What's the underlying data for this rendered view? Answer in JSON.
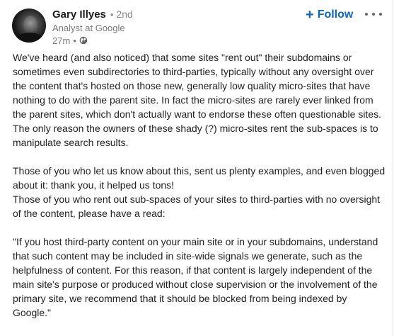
{
  "post": {
    "author": {
      "name": "Gary Illyes",
      "separator": "•",
      "degree": "2nd",
      "headline": "Analyst at Google",
      "time_ago": "27m",
      "meta_separator": "•",
      "visibility_icon": "globe-icon"
    },
    "actions": {
      "follow_label": "Follow",
      "follow_icon": "plus-icon",
      "more_icon": "more-horizontal-icon"
    },
    "paragraphs": [
      "We've heard (and also noticed) that some sites \"rent out\" their subdomains or sometimes even subdirectories to third-parties, typically without any oversight over the content that's hosted on those new, generally low quality micro-sites that have nothing to do with the parent site. In fact the micro-sites are rarely ever linked from the parent sites, which don't actually want to endorse these often questionable sites. The only reason the owners of these shady (?) micro-sites rent the sub-spaces is to manipulate search results.",
      "Those of you who let us know about this, sent us plenty examples, and even blogged about it: thank you, it helped us tons!",
      "Those of you who rent out sub-spaces of your sites to third-parties with no oversight of the content, please have a read:",
      "\"If you host third-party content on your main site or in your subdomains, understand that such content may be included in site-wide signals we generate, such as the helpfulness of content. For this reason, if that content is largely independent of the main site's purpose or produced without close supervision or the involvement of the primary site, we recommend that it should be blocked from being indexed by Google.\""
    ]
  },
  "colors": {
    "accent": "#0a66c2",
    "text": "#1f1f1f",
    "muted": "#7a7a7a"
  }
}
